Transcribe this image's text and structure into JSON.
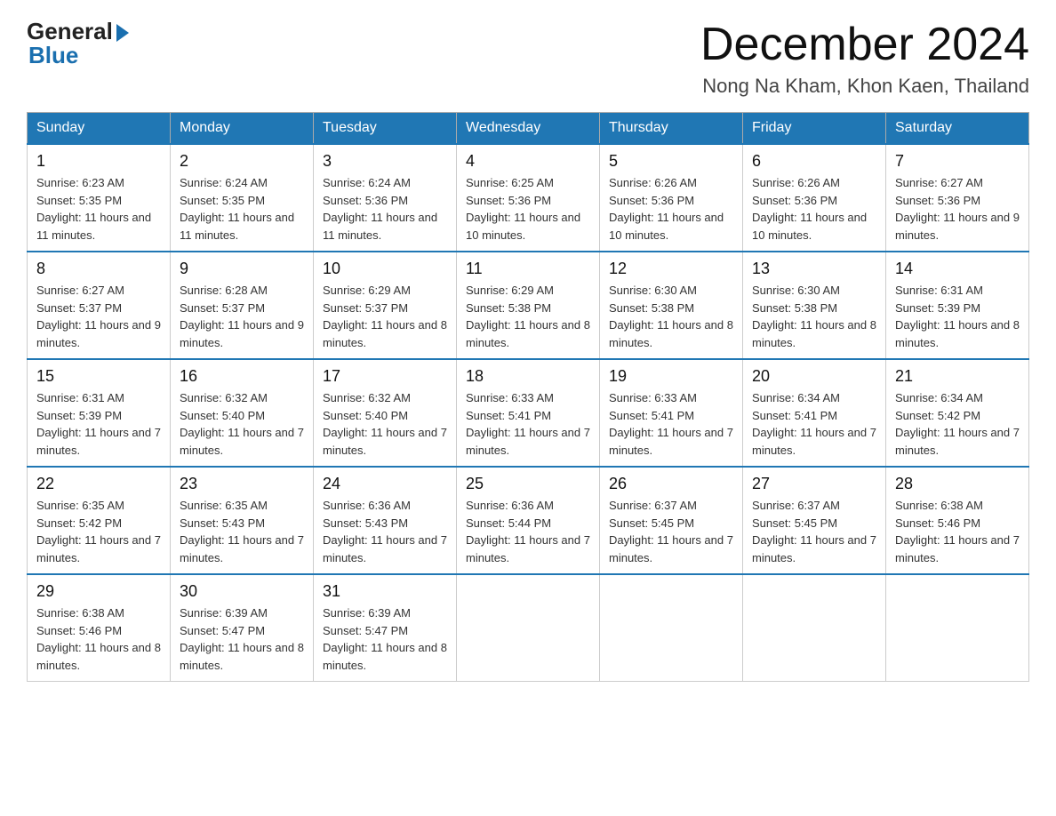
{
  "header": {
    "logo_text": "General",
    "logo_blue": "Blue",
    "month": "December 2024",
    "location": "Nong Na Kham, Khon Kaen, Thailand"
  },
  "days_of_week": [
    "Sunday",
    "Monday",
    "Tuesday",
    "Wednesday",
    "Thursday",
    "Friday",
    "Saturday"
  ],
  "weeks": [
    [
      {
        "day": "1",
        "sunrise": "6:23 AM",
        "sunset": "5:35 PM",
        "daylight": "11 hours and 11 minutes."
      },
      {
        "day": "2",
        "sunrise": "6:24 AM",
        "sunset": "5:35 PM",
        "daylight": "11 hours and 11 minutes."
      },
      {
        "day": "3",
        "sunrise": "6:24 AM",
        "sunset": "5:36 PM",
        "daylight": "11 hours and 11 minutes."
      },
      {
        "day": "4",
        "sunrise": "6:25 AM",
        "sunset": "5:36 PM",
        "daylight": "11 hours and 10 minutes."
      },
      {
        "day": "5",
        "sunrise": "6:26 AM",
        "sunset": "5:36 PM",
        "daylight": "11 hours and 10 minutes."
      },
      {
        "day": "6",
        "sunrise": "6:26 AM",
        "sunset": "5:36 PM",
        "daylight": "11 hours and 10 minutes."
      },
      {
        "day": "7",
        "sunrise": "6:27 AM",
        "sunset": "5:36 PM",
        "daylight": "11 hours and 9 minutes."
      }
    ],
    [
      {
        "day": "8",
        "sunrise": "6:27 AM",
        "sunset": "5:37 PM",
        "daylight": "11 hours and 9 minutes."
      },
      {
        "day": "9",
        "sunrise": "6:28 AM",
        "sunset": "5:37 PM",
        "daylight": "11 hours and 9 minutes."
      },
      {
        "day": "10",
        "sunrise": "6:29 AM",
        "sunset": "5:37 PM",
        "daylight": "11 hours and 8 minutes."
      },
      {
        "day": "11",
        "sunrise": "6:29 AM",
        "sunset": "5:38 PM",
        "daylight": "11 hours and 8 minutes."
      },
      {
        "day": "12",
        "sunrise": "6:30 AM",
        "sunset": "5:38 PM",
        "daylight": "11 hours and 8 minutes."
      },
      {
        "day": "13",
        "sunrise": "6:30 AM",
        "sunset": "5:38 PM",
        "daylight": "11 hours and 8 minutes."
      },
      {
        "day": "14",
        "sunrise": "6:31 AM",
        "sunset": "5:39 PM",
        "daylight": "11 hours and 8 minutes."
      }
    ],
    [
      {
        "day": "15",
        "sunrise": "6:31 AM",
        "sunset": "5:39 PM",
        "daylight": "11 hours and 7 minutes."
      },
      {
        "day": "16",
        "sunrise": "6:32 AM",
        "sunset": "5:40 PM",
        "daylight": "11 hours and 7 minutes."
      },
      {
        "day": "17",
        "sunrise": "6:32 AM",
        "sunset": "5:40 PM",
        "daylight": "11 hours and 7 minutes."
      },
      {
        "day": "18",
        "sunrise": "6:33 AM",
        "sunset": "5:41 PM",
        "daylight": "11 hours and 7 minutes."
      },
      {
        "day": "19",
        "sunrise": "6:33 AM",
        "sunset": "5:41 PM",
        "daylight": "11 hours and 7 minutes."
      },
      {
        "day": "20",
        "sunrise": "6:34 AM",
        "sunset": "5:41 PM",
        "daylight": "11 hours and 7 minutes."
      },
      {
        "day": "21",
        "sunrise": "6:34 AM",
        "sunset": "5:42 PM",
        "daylight": "11 hours and 7 minutes."
      }
    ],
    [
      {
        "day": "22",
        "sunrise": "6:35 AM",
        "sunset": "5:42 PM",
        "daylight": "11 hours and 7 minutes."
      },
      {
        "day": "23",
        "sunrise": "6:35 AM",
        "sunset": "5:43 PM",
        "daylight": "11 hours and 7 minutes."
      },
      {
        "day": "24",
        "sunrise": "6:36 AM",
        "sunset": "5:43 PM",
        "daylight": "11 hours and 7 minutes."
      },
      {
        "day": "25",
        "sunrise": "6:36 AM",
        "sunset": "5:44 PM",
        "daylight": "11 hours and 7 minutes."
      },
      {
        "day": "26",
        "sunrise": "6:37 AM",
        "sunset": "5:45 PM",
        "daylight": "11 hours and 7 minutes."
      },
      {
        "day": "27",
        "sunrise": "6:37 AM",
        "sunset": "5:45 PM",
        "daylight": "11 hours and 7 minutes."
      },
      {
        "day": "28",
        "sunrise": "6:38 AM",
        "sunset": "5:46 PM",
        "daylight": "11 hours and 7 minutes."
      }
    ],
    [
      {
        "day": "29",
        "sunrise": "6:38 AM",
        "sunset": "5:46 PM",
        "daylight": "11 hours and 8 minutes."
      },
      {
        "day": "30",
        "sunrise": "6:39 AM",
        "sunset": "5:47 PM",
        "daylight": "11 hours and 8 minutes."
      },
      {
        "day": "31",
        "sunrise": "6:39 AM",
        "sunset": "5:47 PM",
        "daylight": "11 hours and 8 minutes."
      },
      null,
      null,
      null,
      null
    ]
  ],
  "sunrise_label": "Sunrise:",
  "sunset_label": "Sunset:",
  "daylight_label": "Daylight:"
}
